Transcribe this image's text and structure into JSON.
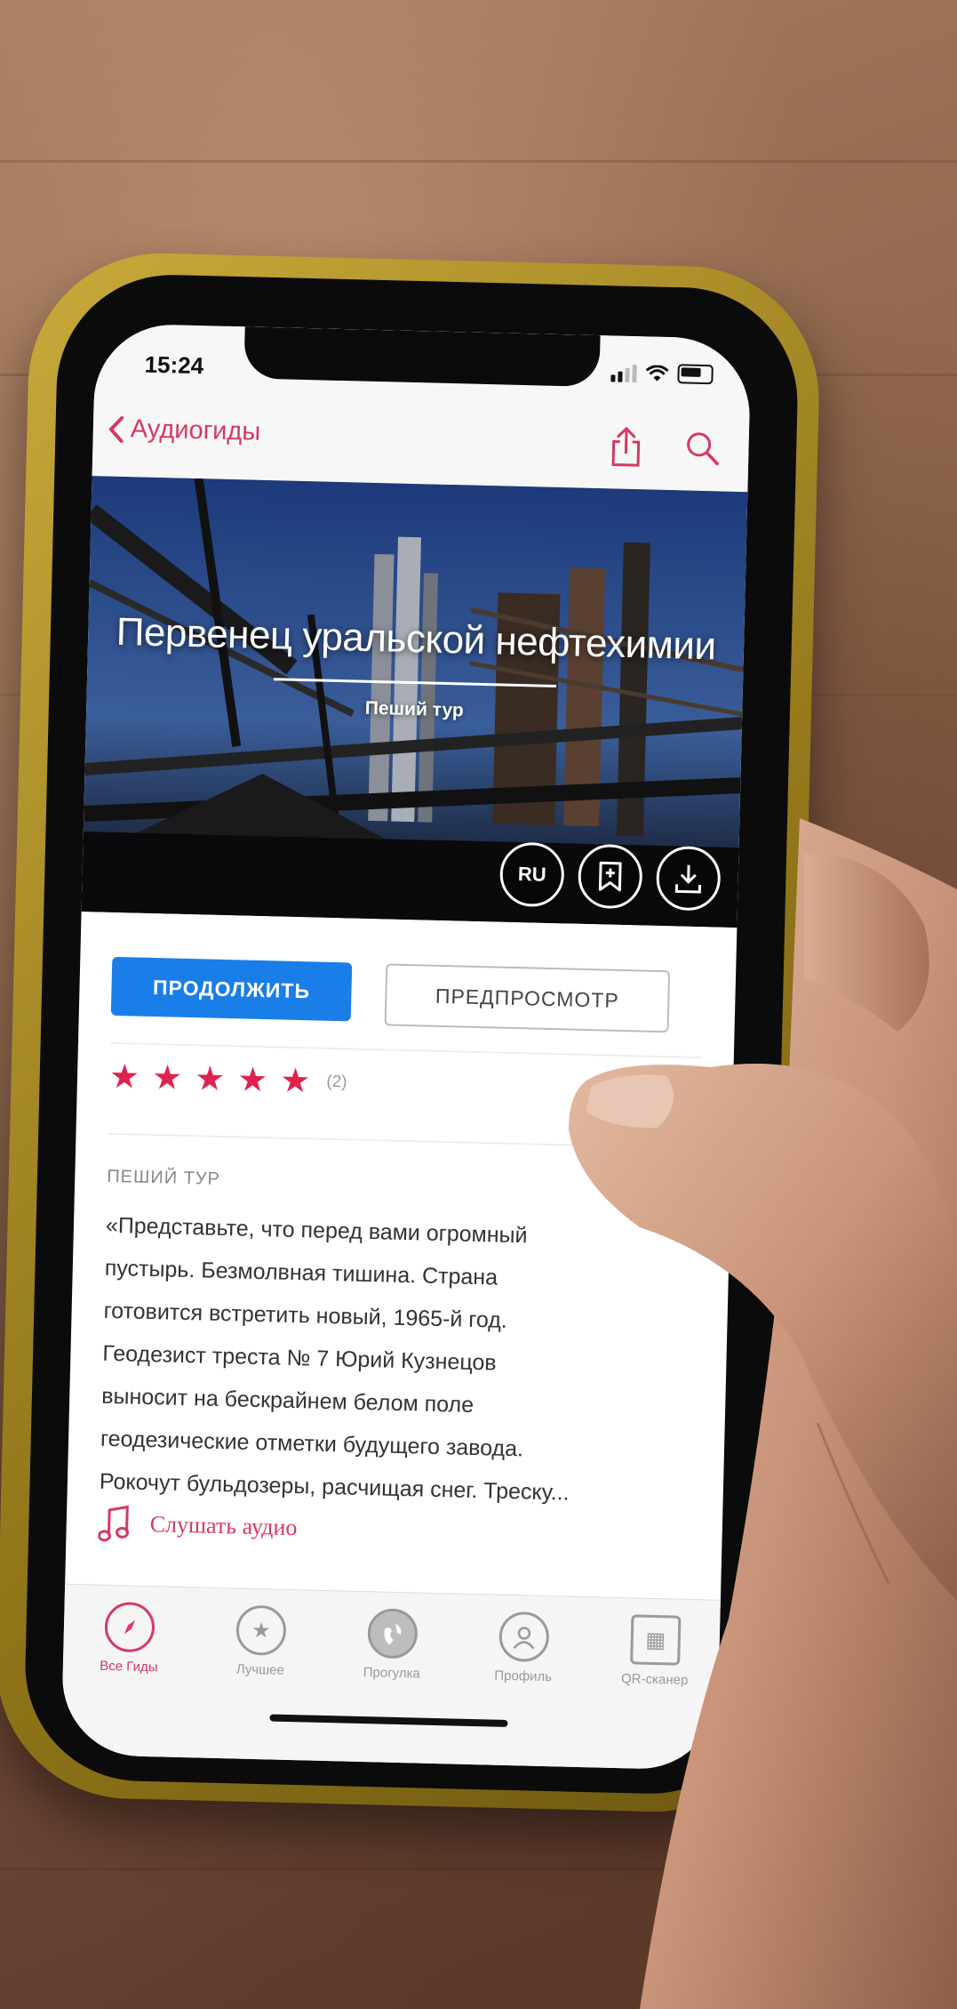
{
  "status_bar": {
    "time": "15:24"
  },
  "navbar": {
    "back_label": "Аудиогиды",
    "share_icon": "share-icon",
    "search_icon": "search-icon"
  },
  "hero": {
    "title": "Первенец уральской нефтехимии",
    "subtitle": "Пеший тур",
    "language_badge": "RU",
    "bookmark_icon": "bookmark-icon",
    "download_icon": "download-icon"
  },
  "actions": {
    "continue_label": "ПРОДОЛЖИТЬ",
    "preview_label": "ПРЕДПРОСМОТР"
  },
  "rating": {
    "stars": 5,
    "count": "(2)"
  },
  "description": {
    "label": "ПЕШИЙ ТУР",
    "text": "«Представьте, что перед вами огромный\nпустырь. Безмолвная тишина. Страна\nготовится встретить новый, 1965-й год.\nГеодезист треста № 7 Юрий Кузнецов\nвыносит на бескрайнем белом поле\nгеодезические отметки будущего завода.\nРокочут бульдозеры, расчищая снег. Треску..."
  },
  "audio": {
    "label": "Слушать аудио",
    "icon": "music-note-icon"
  },
  "tabbar": {
    "tabs": [
      {
        "label": "Все Гиды",
        "icon": "compass-icon"
      },
      {
        "label": "Лучшее",
        "icon": "star-icon"
      },
      {
        "label": "Прогулка",
        "icon": "globe-icon"
      },
      {
        "label": "Профиль",
        "icon": "profile-icon"
      },
      {
        "label": "QR-сканер",
        "icon": "qr-icon"
      }
    ]
  },
  "colors": {
    "accent": "#d63961",
    "primary_button": "#1a7ee8",
    "star": "#e0224e",
    "case": "#b89a2a"
  }
}
